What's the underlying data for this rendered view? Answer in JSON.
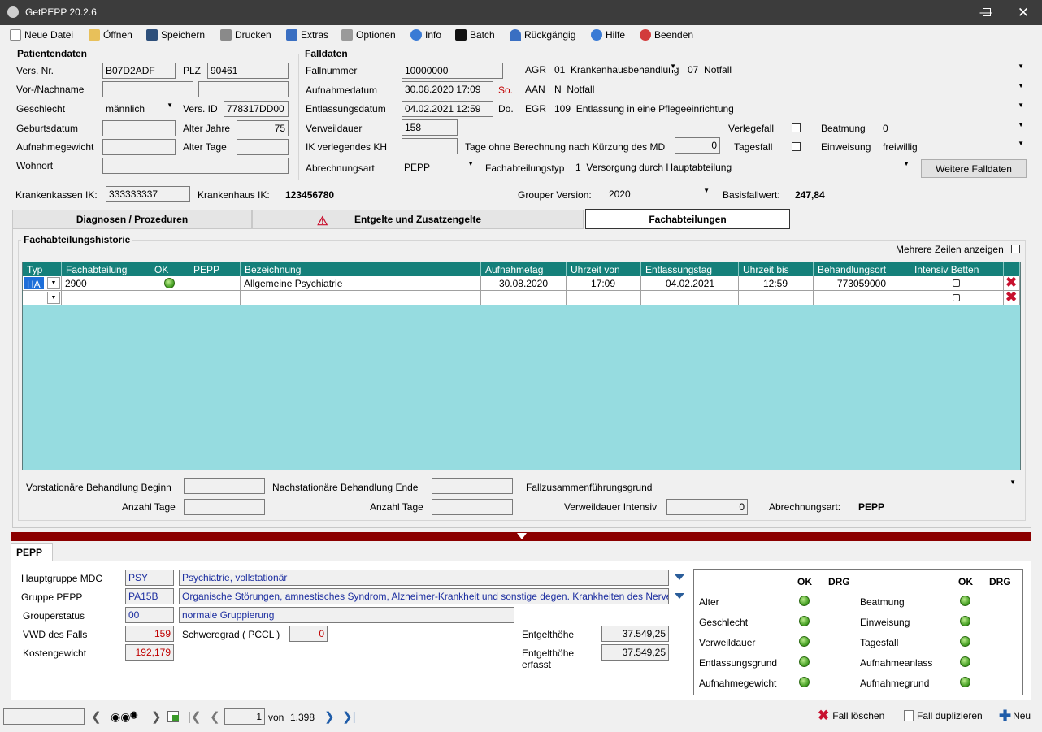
{
  "window": {
    "title": "GetPEPP 20.2.6"
  },
  "toolbar": [
    {
      "label": "Neue Datei",
      "icon": "new-file-icon"
    },
    {
      "label": "Öffnen",
      "icon": "open-folder-icon"
    },
    {
      "label": "Speichern",
      "icon": "save-disk-icon"
    },
    {
      "label": "Drucken",
      "icon": "printer-icon"
    },
    {
      "label": "Extras",
      "icon": "puzzle-icon"
    },
    {
      "label": "Optionen",
      "icon": "options-icon"
    },
    {
      "label": "Info",
      "icon": "info-icon"
    },
    {
      "label": "Batch",
      "icon": "terminal-icon"
    },
    {
      "label": "Rückgängig",
      "icon": "undo-icon"
    },
    {
      "label": "Hilfe",
      "icon": "help-icon"
    },
    {
      "label": "Beenden",
      "icon": "exit-icon"
    }
  ],
  "patient": {
    "title": "Patientendaten",
    "vers_nr_label": "Vers. Nr.",
    "vers_nr": "B07D2ADF",
    "plz_label": "PLZ",
    "plz": "90461",
    "name_label": "Vor-/Nachname",
    "vorname": "",
    "nachname": "",
    "geschlecht_label": "Geschlecht",
    "geschlecht": "männlich",
    "vers_id_label": "Vers. ID",
    "vers_id": "778317DD00",
    "geburtsdatum_label": "Geburtsdatum",
    "geburtsdatum": "",
    "alter_jahre_label": "Alter Jahre",
    "alter_jahre": "75",
    "aufnahmegewicht_label": "Aufnahmegewicht",
    "aufnahmegewicht": "",
    "alter_tage_label": "Alter Tage",
    "alter_tage": "",
    "wohnort_label": "Wohnort",
    "wohnort": ""
  },
  "fall": {
    "title": "Falldaten",
    "fallnummer_label": "Fallnummer",
    "fallnummer": "10000000",
    "aufnahmedatum_label": "Aufnahmedatum",
    "aufnahmedatum": "30.08.2020 17:09",
    "aufnahme_tag": "So.",
    "entlassungsdatum_label": "Entlassungsdatum",
    "entlassungsdatum": "04.02.2021 12:59",
    "entlassung_tag": "Do.",
    "verweildauer_label": "Verweildauer",
    "verweildauer": "158",
    "ik_verl_label": "IK verlegendes KH",
    "ik_verl": "",
    "tage_ohne_label": "Tage ohne Berechnung nach Kürzung des MD",
    "tage_ohne": "0",
    "abrechnungsart_label": "Abrechnungsart",
    "abrechnungsart": "PEPP",
    "agr_label": "AGR",
    "agr_code": "01",
    "agr_text": "Krankenhausbehandlung",
    "agr2_code": "07",
    "agr2_text": "Notfall",
    "aan_label": "AAN",
    "aan_code": "N",
    "aan_text": "Notfall",
    "egr_label": "EGR",
    "egr_code": "109",
    "egr_text": "Entlassung in eine Pflegeeinrichtung",
    "verlegefall_label": "Verlegefall",
    "tagesfall_label": "Tagesfall",
    "beatmung_label": "Beatmung",
    "beatmung": "0",
    "einweisung_label": "Einweisung",
    "einweisung": "freiwillig",
    "fachabteilungstyp_label": "Fachabteilungstyp",
    "fachabteilungstyp_code": "1",
    "fachabteilungstyp_text": "Versorgung durch Hauptabteilung",
    "weitere_button": "Weitere Falldaten"
  },
  "ik_row": {
    "kk_label": "Krankenkassen IK:",
    "kk_value": "333333337",
    "kh_label": "Krankenhaus IK:",
    "kh_value": "123456780",
    "grouper_label": "Grouper Version:",
    "grouper_value": "2020",
    "basis_label": "Basisfallwert:",
    "basis_value": "247,84"
  },
  "tabs": [
    {
      "label": "Diagnosen / Prozeduren"
    },
    {
      "label": "Entgelte und Zusatzengelte"
    },
    {
      "label": "Fachabteilungen"
    }
  ],
  "history": {
    "title": "Fachabteilungshistorie",
    "mehrere_label": "Mehrere Zeilen anzeigen",
    "columns": [
      "Typ",
      "Fachabteilung",
      "OK",
      "PEPP",
      "Bezeichnung",
      "Aufnahmetag",
      "Uhrzeit von",
      "Entlassungstag",
      "Uhrzeit bis",
      "Behandlungsort",
      "Intensiv Betten"
    ],
    "rows": [
      {
        "typ": "HA",
        "fachabteilung": "2900",
        "pepp": "",
        "bezeichnung": "Allgemeine Psychiatrie",
        "aufnahmetag": "30.08.2020",
        "uhrzeit_von": "17:09",
        "entlassungstag": "04.02.2021",
        "uhrzeit_bis": "12:59",
        "behandlungsort": "773059000"
      }
    ],
    "vor_label": "Vorstationäre Behandlung Beginn",
    "nach_label": "Nachstationäre Behandlung Ende",
    "fallzus_label": "Fallzusammenführungsgrund",
    "anzahl_tage_label": "Anzahl Tage",
    "anzahl_tage2_label": "Anzahl Tage",
    "vwd_intensiv_label": "Verweildauer Intensiv",
    "vwd_intensiv": "0",
    "abrechnungsart_label": "Abrechnungsart:",
    "abrechnungsart": "PEPP"
  },
  "pepp": {
    "tab": "PEPP",
    "hauptgruppe_label": "Hauptgruppe MDC",
    "hauptgruppe_code": "PSY",
    "hauptgruppe_text": "Psychiatrie, vollstationär",
    "gruppe_label": "Gruppe PEPP",
    "gruppe_code": "PA15B",
    "gruppe_text": "Organische Störungen, amnestisches Syndrom, Alzheimer-Krankheit und sonstige degen. Krankheiten des Nervensystems",
    "status_label": "Grouperstatus",
    "status_code": "00",
    "status_text": "normale Gruppierung",
    "vwd_label": "VWD des Falls",
    "vwd": "159",
    "schweregrad_label": "Schweregrad ( PCCL )",
    "schweregrad": "0",
    "kostengewicht_label": "Kostengewicht",
    "kostengewicht": "192,179",
    "entgelthoehe_label": "Entgelthöhe",
    "entgelthoehe": "37.549,25",
    "entgelthoehe_erfasst_label": "Entgelthöhe erfasst",
    "entgelthoehe_erfasst": "37.549,25",
    "check_ok": "OK",
    "check_drg": "DRG",
    "checks_left": [
      "Alter",
      "Geschlecht",
      "Verweildauer",
      "Entlassungsgrund",
      "Aufnahmegewicht"
    ],
    "checks_right": [
      "Beatmung",
      "Einweisung",
      "Tagesfall",
      "Aufnahmeanlass",
      "Aufnahmegrund"
    ]
  },
  "nav": {
    "page": "1",
    "von_label": "von",
    "total": "1.398",
    "loeschen": "Fall löschen",
    "duplizieren": "Fall duplizieren",
    "neu": "Neu"
  }
}
